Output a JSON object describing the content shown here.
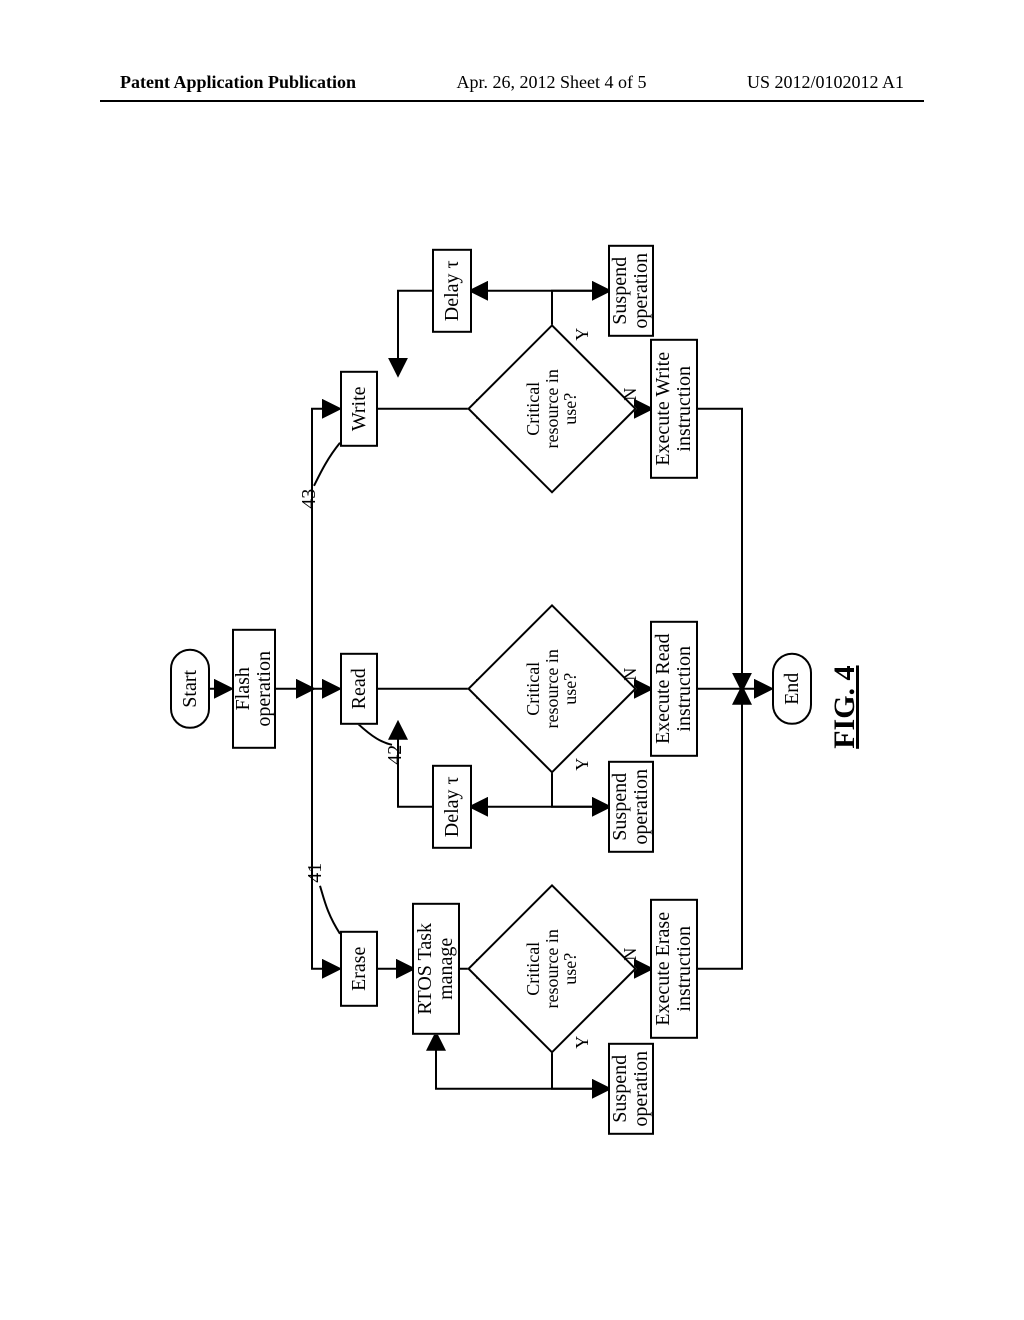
{
  "header": {
    "left": "Patent Application Publication",
    "mid": "Apr. 26, 2012  Sheet 4 of 5",
    "right": "US 2012/0102012 A1"
  },
  "fig": {
    "label": "FIG. 4",
    "start": "Start",
    "end": "End",
    "flash_op": "Flash\noperation",
    "erase": "Erase",
    "read": "Read",
    "write": "Write",
    "rtos": "RTOS Task\nmanage",
    "critical": "Critical\nresource in\nuse?",
    "exec_erase": "Execute Erase\ninstruction",
    "exec_read": "Execute Read\ninstruction",
    "exec_write": "Execute Write\ninstruction",
    "suspend": "Suspend\noperation",
    "delay": "Delay τ",
    "yes": "Y",
    "no": "N",
    "ref41": "41",
    "ref42": "42",
    "ref43": "43"
  }
}
